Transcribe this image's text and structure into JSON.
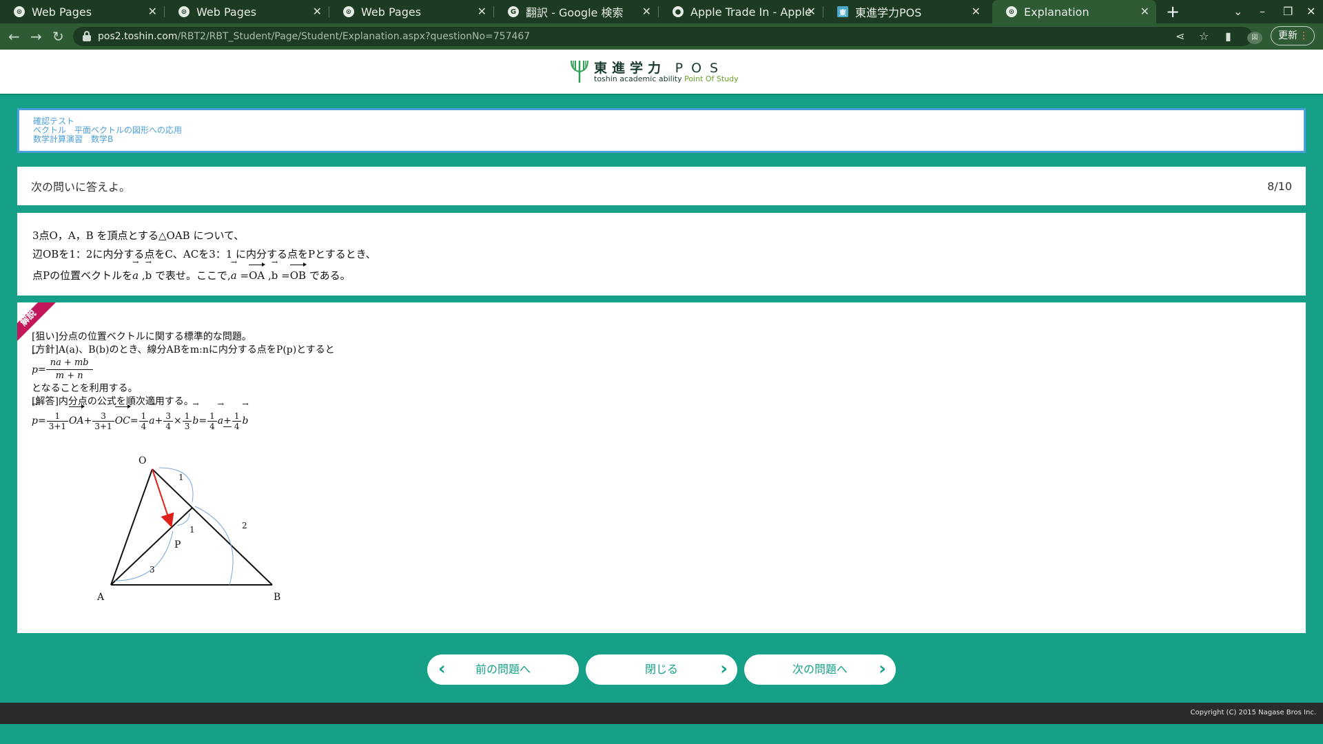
{
  "browser": {
    "tabs": [
      {
        "title": "Web Pages",
        "icon": "web-page-icon"
      },
      {
        "title": "Web Pages",
        "icon": "web-page-icon"
      },
      {
        "title": "Web Pages",
        "icon": "web-page-icon"
      },
      {
        "title": "翻訳 - Google 検索",
        "icon": "google-icon"
      },
      {
        "title": "Apple Trade In - Apple",
        "icon": "apple-icon"
      },
      {
        "title": "東進学力POS",
        "icon": "toshin-icon"
      },
      {
        "title": "Explanation",
        "icon": "web-page-icon"
      }
    ],
    "active_tab": 6,
    "url_host": "pos2.toshin.com",
    "url_path": "/RBT2/RBT_Student/Page/Student/Explanation.aspx?questionNo=757467",
    "update_label": "更新",
    "colors": {
      "tabbar": "#1d3b22",
      "toolbar": "#2e5a34"
    }
  },
  "site": {
    "logo_title": "東進学力",
    "logo_pos": "POS",
    "logo_sub_prefix": "toshin academic ability ",
    "logo_sub_highlight": "Point Of Study"
  },
  "breadcrumb": {
    "line1": "確認テスト",
    "line2": "ベクトル　平面ベクトルの図形への応用",
    "line3": "数学計算演習　数学B"
  },
  "question": {
    "prompt": "次の問いに答えよ。",
    "counter": "8/10",
    "line1": "3点O，A，B を頂点とする△OAB について、",
    "line2": "辺OBを1：2に内分する点をC、ACを3：1 に内分する点をPとするとき、",
    "line3_a": "点Pの位置ベクトルを",
    "line3_b": "で表せ。ここで,",
    "line3_c": "である。",
    "vec_a": "a",
    "vec_b": "b",
    "vec_oa": "OA",
    "vec_ob": "OB"
  },
  "explanation": {
    "badge": "解説",
    "aim": "[狙い]分点の位置ベクトルに関する標準的な問題。",
    "policy": "[方針]A(a)、B(b)のとき、線分ABをm:nに内分する点をP(p)とすると",
    "formula_num": "na + mb",
    "formula_den": "m + n",
    "use": "となることを利用する。",
    "answer_head": "[解答]内分点の公式を順次適用する。",
    "answer_terms": {
      "c1_num": "1",
      "c1_den": "3+1",
      "v1": "OA",
      "c2_num": "3",
      "c2_den": "3+1",
      "v2": "OC",
      "c3_num": "1",
      "c3_den": "4",
      "c4_num": "3",
      "c4_den": "4",
      "c5_num": "1",
      "c5_den": "3",
      "c6_num": "1",
      "c6_den": "4",
      "c7_num": "1",
      "c7_den": "4"
    },
    "diagram": {
      "labels": {
        "O": "O",
        "A": "A",
        "B": "B",
        "P": "P"
      },
      "ratios": {
        "oc": "1",
        "cb": "2",
        "ap": "3",
        "pc": "1"
      },
      "arrow_color": "#e0201c",
      "arc_color": "#7aa6d6"
    }
  },
  "buttons": {
    "prev": "前の問題へ",
    "close": "閉じる",
    "next": "次の問題へ"
  },
  "footer": {
    "copyright": "Copyright (C) 2015 Nagase Bros Inc."
  },
  "theme": {
    "accent": "#17a088",
    "breadcrumb": "#4a9fd8",
    "ribbon": "#c2185b"
  }
}
